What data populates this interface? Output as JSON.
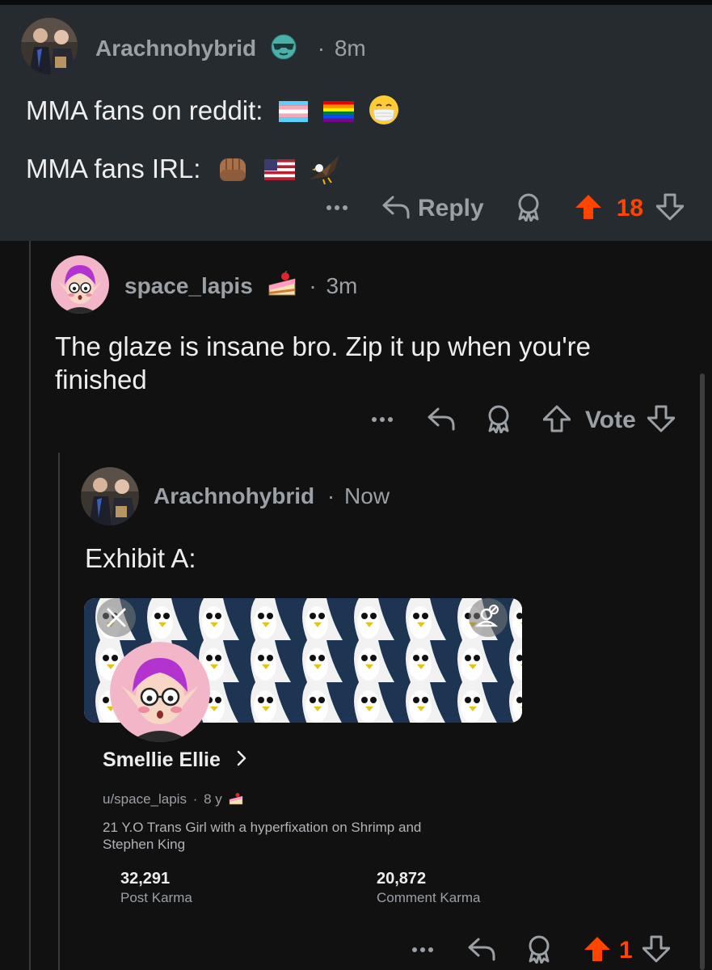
{
  "comment1": {
    "username": "Arachnohybrid",
    "flair_icon": "sunglasses-face-icon",
    "separator": "·",
    "time": "8m",
    "line1_text": "MMA fans on reddit:",
    "line1_emojis": [
      "transgender-flag-icon",
      "rainbow-flag-icon",
      "face-with-mask-icon"
    ],
    "line2_text": "MMA fans IRL:",
    "line2_emojis": [
      "fist-icon",
      "us-flag-icon",
      "eagle-icon"
    ],
    "reply_label": "Reply",
    "score": "18"
  },
  "comment2": {
    "username": "space_lapis",
    "flair_icon": "cake-icon",
    "separator": "·",
    "time": "3m",
    "text": "The glaze is insane bro. Zip it up when you're finished",
    "vote_label": "Vote"
  },
  "comment3": {
    "username": "Arachnohybrid",
    "separator": "·",
    "time": "Now",
    "text": "Exhibit A:",
    "score": "1",
    "profile_card": {
      "display_name": "Smellie Ellie",
      "handle": "u/space_lapis",
      "age": "8 y",
      "bio": "21 Y.O Trans Girl with a hyperfixation on Shrimp and Stephen King",
      "post_karma_value": "32,291",
      "post_karma_label": "Post Karma",
      "comment_karma_value": "20,872",
      "comment_karma_label": "Comment Karma"
    }
  },
  "colors": {
    "upvote_active": "#ff4500",
    "comment1_background": "#262b30",
    "page_background": "#111111",
    "muted_text": "#9aa0a6"
  }
}
